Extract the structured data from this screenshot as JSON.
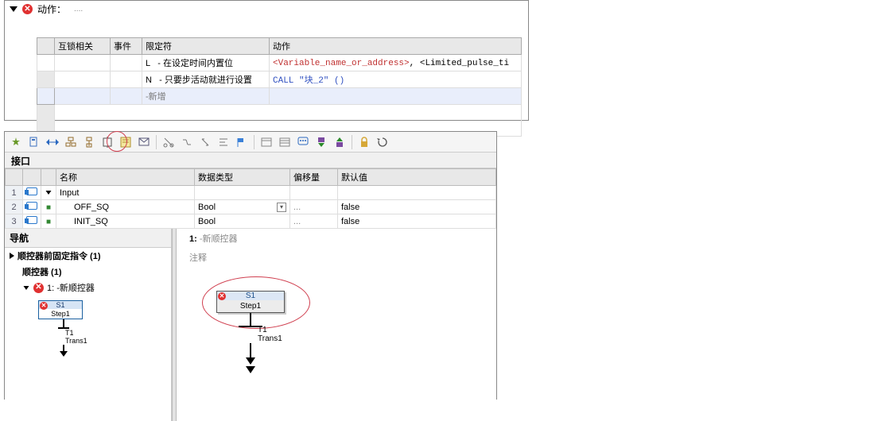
{
  "top": {
    "title": "动作：",
    "dots": "....",
    "cols": {
      "interlock": "互锁相关",
      "event": "事件",
      "qualifier": "限定符",
      "action": "动作"
    },
    "rows": [
      {
        "qual_letter": "L",
        "qual_text": "- 在设定时间内置位",
        "action_var": "<Variable_name_or_address>",
        "action_rest": ", <Limited_pulse_ti"
      },
      {
        "qual_letter": "N",
        "qual_text": "- 只要步活动就进行设置",
        "action_call": "CALL \"块_2\" ()"
      }
    ],
    "add_label": "-新增"
  },
  "iface": {
    "header": "接口",
    "cols": {
      "name": "名称",
      "dtype": "数据类型",
      "offset": "偏移量",
      "default": "默认值"
    },
    "rows": [
      {
        "n": "1",
        "kind": "folder",
        "name": "Input",
        "dtype": "",
        "offset": "",
        "default": ""
      },
      {
        "n": "2",
        "kind": "var",
        "name": "OFF_SQ",
        "dtype": "Bool",
        "offset": "...",
        "default": "false"
      },
      {
        "n": "3",
        "kind": "var",
        "name": "INIT_SQ",
        "dtype": "Bool",
        "offset": "...",
        "default": "false"
      }
    ]
  },
  "nav": {
    "header": "导航",
    "pre": "顺控器前固定指令 (1)",
    "sqc": "顺控器 (1)",
    "item1": "1: -新顺控器",
    "thumb": {
      "s1": "S1",
      "s1lbl": "Step1",
      "t1": "T1",
      "t1lbl": "Trans1"
    }
  },
  "canvas": {
    "title_n": "1:",
    "title_t": "-新顺控器",
    "comment": "注释",
    "step": {
      "s1": "S1",
      "s1lbl": "Step1",
      "t1": "T1",
      "t1lbl": "Trans1"
    }
  },
  "icons": {
    "t1": "wizard",
    "t2": "bookmark",
    "t3": "hscroll",
    "t4": "hier1",
    "t5": "hier2",
    "t6": "step",
    "t7": "props",
    "t8": "mail",
    "t9": "cut",
    "t10": "break",
    "t11": "link",
    "t12": "align",
    "t13": "flag",
    "t14": "rows1",
    "t15": "rows2",
    "t16": "bubble",
    "t17": "down",
    "t18": "up",
    "t19": "lock",
    "t20": "refresh"
  }
}
